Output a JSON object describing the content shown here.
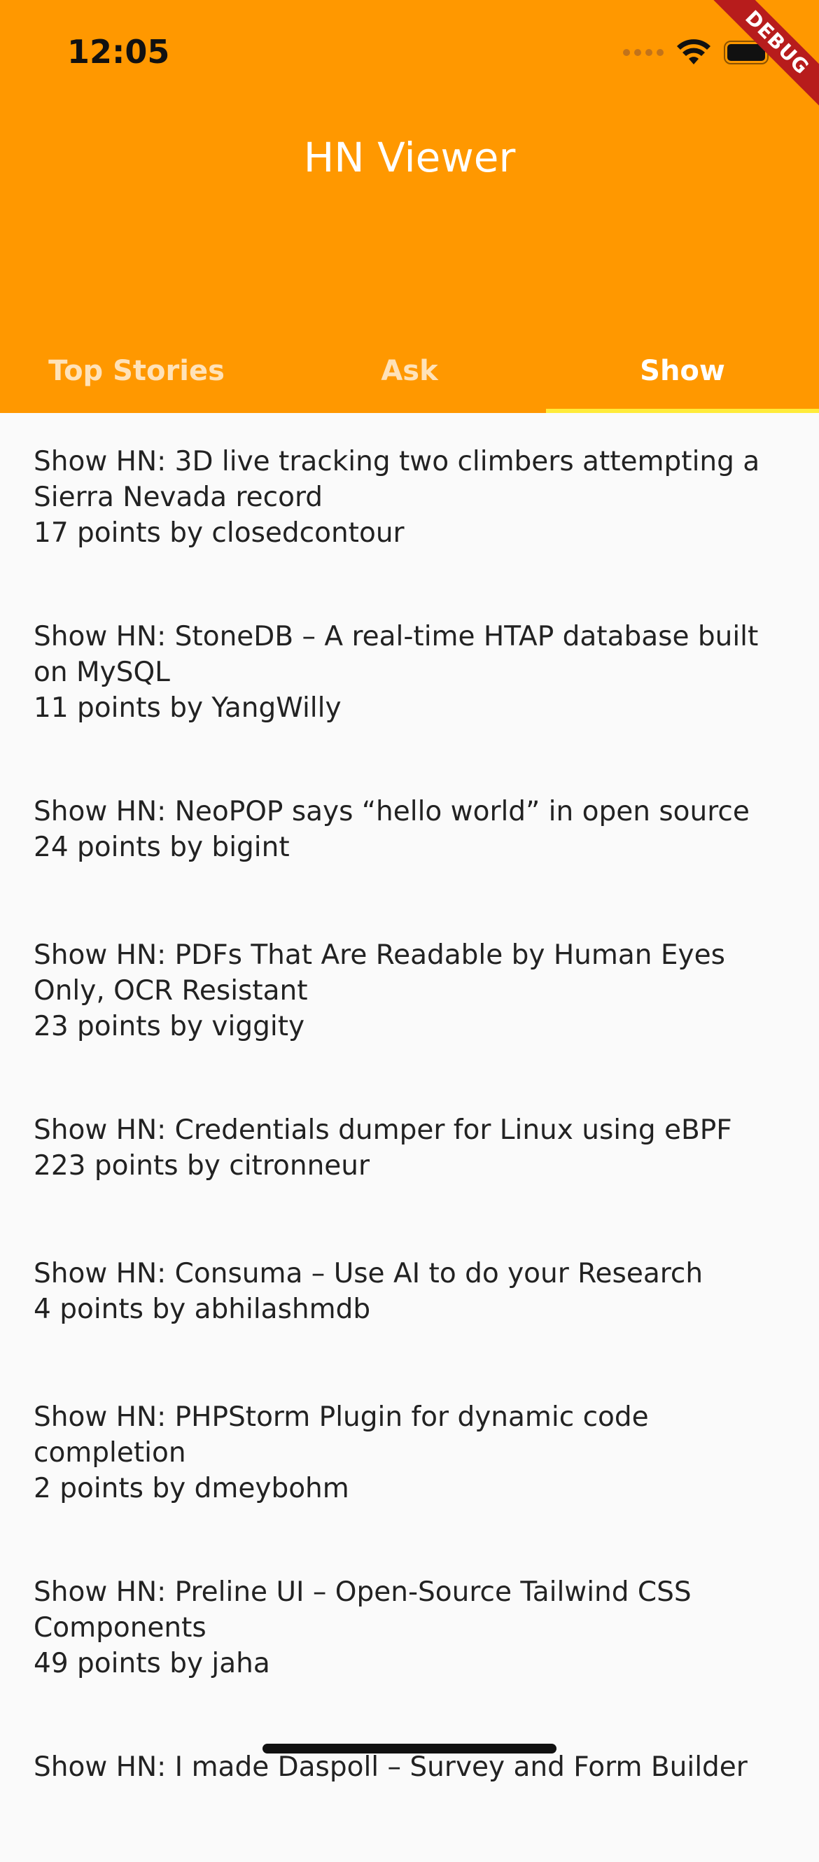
{
  "status_bar": {
    "time": "12:05"
  },
  "debug_banner": "DEBUG",
  "app_bar": {
    "title": "HN Viewer",
    "color": "#ff9800",
    "indicator_color": "#ffeb3b"
  },
  "tabs": [
    {
      "label": "Top Stories",
      "active": false
    },
    {
      "label": "Ask",
      "active": false
    },
    {
      "label": "Show",
      "active": true
    }
  ],
  "stories": [
    {
      "title": "Show HN: 3D live tracking two climbers attempting a Sierra Nevada record",
      "meta": "17 points by closedcontour"
    },
    {
      "title": "Show HN: StoneDB – A real-time HTAP database built on MySQL",
      "meta": "11 points by YangWilly"
    },
    {
      "title": "Show HN: NeoPOP says “hello world” in open source",
      "meta": "24 points by bigint"
    },
    {
      "title": "Show HN: PDFs That Are Readable by Human Eyes Only, OCR Resistant",
      "meta": "23 points by viggity"
    },
    {
      "title": "Show HN: Credentials dumper for Linux using eBPF",
      "meta": "223 points by citronneur"
    },
    {
      "title": "Show HN: Consuma – Use AI to do your Research",
      "meta": "4 points by abhilashmdb"
    },
    {
      "title": "Show HN: PHPStorm Plugin for dynamic code completion",
      "meta": "2 points by dmeybohm"
    },
    {
      "title": "Show HN: Preline UI – Open-Source Tailwind CSS Components",
      "meta": "49 points by jaha"
    },
    {
      "title": "Show HN: I made Daspoll – Survey and Form Builder",
      "meta": ""
    }
  ]
}
